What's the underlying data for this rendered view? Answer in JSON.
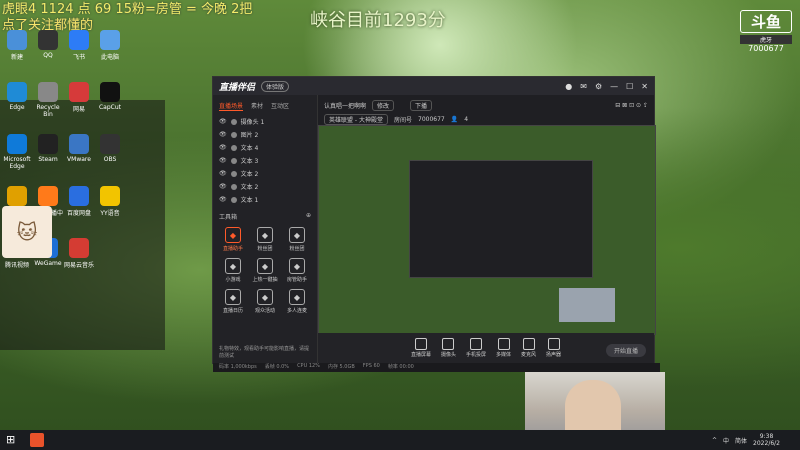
{
  "overlay": {
    "line1": "虎眼4 1124 点 69 15粉=房管 = 今晚 2把",
    "line2": "点了关注都懂的",
    "center_title": "峡谷目前1293分"
  },
  "watermark": {
    "logo": "斗鱼",
    "badge": "虎牙",
    "room_id": "7000677"
  },
  "desktop_icons": [
    {
      "label": "新建",
      "icon": "monitor-icon",
      "color": "#4a90d9"
    },
    {
      "label": "QQ",
      "icon": "qq-icon",
      "color": "#333"
    },
    {
      "label": "飞书",
      "icon": "feishu-icon",
      "color": "#2d7cf6"
    },
    {
      "label": "此电脑",
      "icon": "pc-icon",
      "color": "#5aa0e8"
    },
    {
      "label": "Edge",
      "icon": "edge-icon",
      "color": "#1f8bd6"
    },
    {
      "label": "Recycle Bin",
      "icon": "recycle-icon",
      "color": "#888"
    },
    {
      "label": "网易",
      "icon": "netease-icon",
      "color": "#d63a3a"
    },
    {
      "label": "CapCut",
      "icon": "capcut-icon",
      "color": "#111"
    },
    {
      "label": "Microsoft Edge",
      "icon": "edge2-icon",
      "color": "#0f7ad9"
    },
    {
      "label": "Steam",
      "icon": "steam-icon",
      "color": "#222"
    },
    {
      "label": "VMware",
      "icon": "vm-icon",
      "color": "#3a76c4"
    },
    {
      "label": "OBS",
      "icon": "obs-icon",
      "color": "#333"
    },
    {
      "label": "Game",
      "icon": "game-icon",
      "color": "#e0a000"
    },
    {
      "label": "斗鱼直播中心",
      "icon": "douyu-icon",
      "color": "#ff7a1a"
    },
    {
      "label": "百度网盘",
      "icon": "baidu-icon",
      "color": "#2a6ee0"
    },
    {
      "label": "YY语音",
      "icon": "yy-icon",
      "color": "#f2c400"
    },
    {
      "label": "腾讯视频",
      "icon": "tencent-icon",
      "color": "#ff4a4a"
    },
    {
      "label": "WeGame",
      "icon": "wegame-icon",
      "color": "#1d6fd6"
    },
    {
      "label": "网易云音乐",
      "icon": "music-icon",
      "color": "#d43c33"
    }
  ],
  "app": {
    "name": "直播伴侣",
    "version_label": "体验版",
    "tabs": [
      "直播场景",
      "素材",
      "互动区"
    ],
    "scenes": [
      "摄像头 1",
      "图片 2",
      "文本 4",
      "文本 3",
      "文本 2",
      "文本 2",
      "文本 1"
    ],
    "tools_title": "工具箱",
    "tools": [
      {
        "label": "直播助手",
        "hot": true
      },
      {
        "label": "粉丝团",
        "hot": false
      },
      {
        "label": "粉丝团",
        "hot": false
      },
      {
        "label": "小游戏",
        "hot": false
      },
      {
        "label": "上热一键抽",
        "hot": false
      },
      {
        "label": "房管助手",
        "hot": false
      },
      {
        "label": "直播日历",
        "hot": false
      },
      {
        "label": "观众活动",
        "hot": false
      },
      {
        "label": "多人连麦",
        "hot": false
      }
    ],
    "topbar": {
      "title": "认真唱一把啊啊",
      "edit_label": "修改",
      "stream_btn": "下播",
      "category": "英雄联盟 - 大神殿堂",
      "room_label": "房间号",
      "room_value": "7000677",
      "viewers": "4"
    },
    "bottom_tools": [
      "直播屏幕",
      "摄像头",
      "手机投屏",
      "多媒体",
      "麦克风",
      "扬声器"
    ],
    "start_button": "开始直播",
    "status_items": [
      "码率 1,000kbps",
      "丢帧 0.0%",
      "CPU 12%",
      "内存 5.0GB",
      "FPS 60",
      "帧率 00:00"
    ],
    "notice": "礼物特效，观看助手可能影响直播，请提前测试"
  },
  "taskbar": {
    "ime": "中",
    "lang": "简体",
    "time": "9:38",
    "date": "2022/6/2"
  }
}
